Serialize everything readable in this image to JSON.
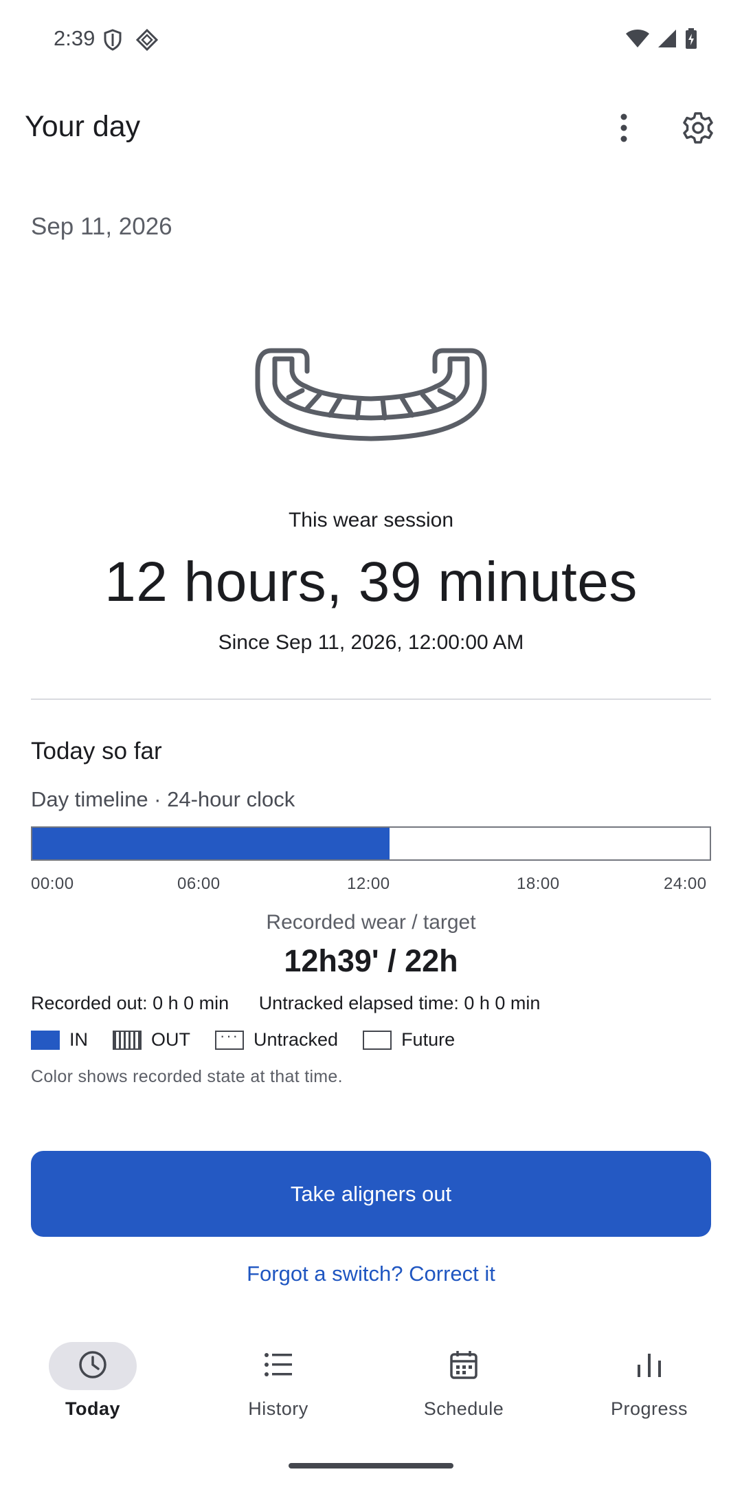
{
  "status_bar": {
    "time": "2:39",
    "left_icons": [
      "shield-icon",
      "diamond-network-icon"
    ],
    "right_icons": [
      "wifi-icon",
      "signal-icon",
      "battery-charging-icon"
    ]
  },
  "app_bar": {
    "title": "Your day",
    "actions": [
      "more-vert-icon",
      "settings-gear-icon"
    ]
  },
  "date": "Sep 11, 2026",
  "session": {
    "label": "This wear session",
    "duration": "12 hours, 39 minutes",
    "since": "Since Sep 11, 2026, 12:00:00 AM"
  },
  "today": {
    "section_title": "Today so far",
    "timeline_caption": "Day timeline · 24-hour clock",
    "timeline_fill_fraction": 0.527,
    "ticks": [
      "00:00",
      "06:00",
      "12:00",
      "18:00",
      "24:00"
    ],
    "ratio_label": "Recorded wear / target",
    "ratio_value": "12h39' / 22h",
    "recorded_out": "Recorded out: 0 h 0 min",
    "untracked_elapsed": "Untracked elapsed time: 0 h 0 min",
    "legend": {
      "in": "IN",
      "out": "OUT",
      "untracked": "Untracked",
      "future": "Future"
    },
    "color_note": "Color shows recorded state at that time."
  },
  "actions": {
    "primary": "Take aligners out",
    "correct_link": "Forgot a switch? Correct it"
  },
  "bottom_nav": {
    "today": "Today",
    "history": "History",
    "schedule": "Schedule",
    "progress": "Progress",
    "active": "Today"
  },
  "colors": {
    "accent": "#2459c3",
    "link": "#1f56c1",
    "text": "#1b1c20",
    "muted": "#5b5e66"
  }
}
